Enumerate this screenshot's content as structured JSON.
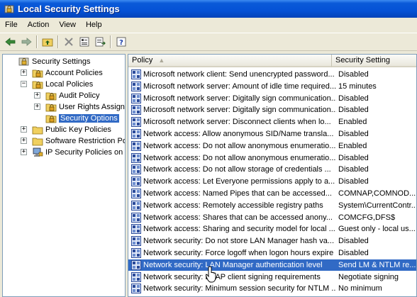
{
  "window": {
    "title": "Local Security Settings"
  },
  "menu": [
    "File",
    "Action",
    "View",
    "Help"
  ],
  "toolbar": [
    "back-icon",
    "forward-icon",
    "up-folder-icon",
    "delete-icon",
    "properties-icon",
    "export-list-icon",
    "help-icon"
  ],
  "tree": [
    {
      "label": "Security Settings",
      "depth": 0,
      "icon": "security-settings-icon",
      "expander": ""
    },
    {
      "label": "Account Policies",
      "depth": 1,
      "icon": "lock-folder-icon",
      "expander": "+"
    },
    {
      "label": "Local Policies",
      "depth": 1,
      "icon": "lock-folder-icon",
      "expander": "-"
    },
    {
      "label": "Audit Policy",
      "depth": 2,
      "icon": "lock-folder-icon",
      "expander": "+"
    },
    {
      "label": "User Rights Assignmer",
      "depth": 2,
      "icon": "lock-folder-icon",
      "expander": "+"
    },
    {
      "label": "Security Options",
      "depth": 2,
      "icon": "lock-folder-icon",
      "expander": "",
      "selected": true
    },
    {
      "label": "Public Key Policies",
      "depth": 1,
      "icon": "folder-icon",
      "expander": "+"
    },
    {
      "label": "Software Restriction Policie",
      "depth": 1,
      "icon": "folder-icon",
      "expander": "+"
    },
    {
      "label": "IP Security Policies on Loc",
      "depth": 1,
      "icon": "ip-security-icon",
      "expander": "+"
    }
  ],
  "columns": {
    "policy": "Policy",
    "setting": "Security Setting"
  },
  "rows": [
    {
      "policy": "Microsoft network client: Send unencrypted password...",
      "setting": "Disabled"
    },
    {
      "policy": "Microsoft network server: Amount of idle time required...",
      "setting": "15 minutes"
    },
    {
      "policy": "Microsoft network server: Digitally sign communication...",
      "setting": "Disabled"
    },
    {
      "policy": "Microsoft network server: Digitally sign communication...",
      "setting": "Disabled"
    },
    {
      "policy": "Microsoft network server: Disconnect clients when lo...",
      "setting": "Enabled"
    },
    {
      "policy": "Network access: Allow anonymous SID/Name transla...",
      "setting": "Disabled"
    },
    {
      "policy": "Network access: Do not allow anonymous enumeratio...",
      "setting": "Enabled"
    },
    {
      "policy": "Network access: Do not allow anonymous enumeratio...",
      "setting": "Disabled"
    },
    {
      "policy": "Network access: Do not allow storage of credentials ...",
      "setting": "Disabled"
    },
    {
      "policy": "Network access: Let Everyone permissions apply to a...",
      "setting": "Disabled"
    },
    {
      "policy": "Network access: Named Pipes that can be accessed...",
      "setting": "COMNAP,COMNOD..."
    },
    {
      "policy": "Network access: Remotely accessible registry paths",
      "setting": "System\\CurrentContr..."
    },
    {
      "policy": "Network access: Shares that can be accessed anony...",
      "setting": "COMCFG,DFS$"
    },
    {
      "policy": "Network access: Sharing and security model for local ...",
      "setting": "Guest only - local us..."
    },
    {
      "policy": "Network security: Do not store LAN Manager hash va...",
      "setting": "Disabled"
    },
    {
      "policy": "Network security: Force logoff when logon hours expire",
      "setting": "Disabled"
    },
    {
      "policy": "Network security: LAN Manager authentication level",
      "setting": "Send LM & NTLM re...",
      "selected": true
    },
    {
      "policy": "Network security: LDAP client signing requirements",
      "setting": "Negotiate signing"
    },
    {
      "policy": "Network security: Minimum session security for NTLM ...",
      "setting": "No minimum"
    }
  ],
  "colors": {
    "selection": "#316ac5",
    "titlebar": "#0552d6",
    "chrome": "#ece9d8"
  }
}
